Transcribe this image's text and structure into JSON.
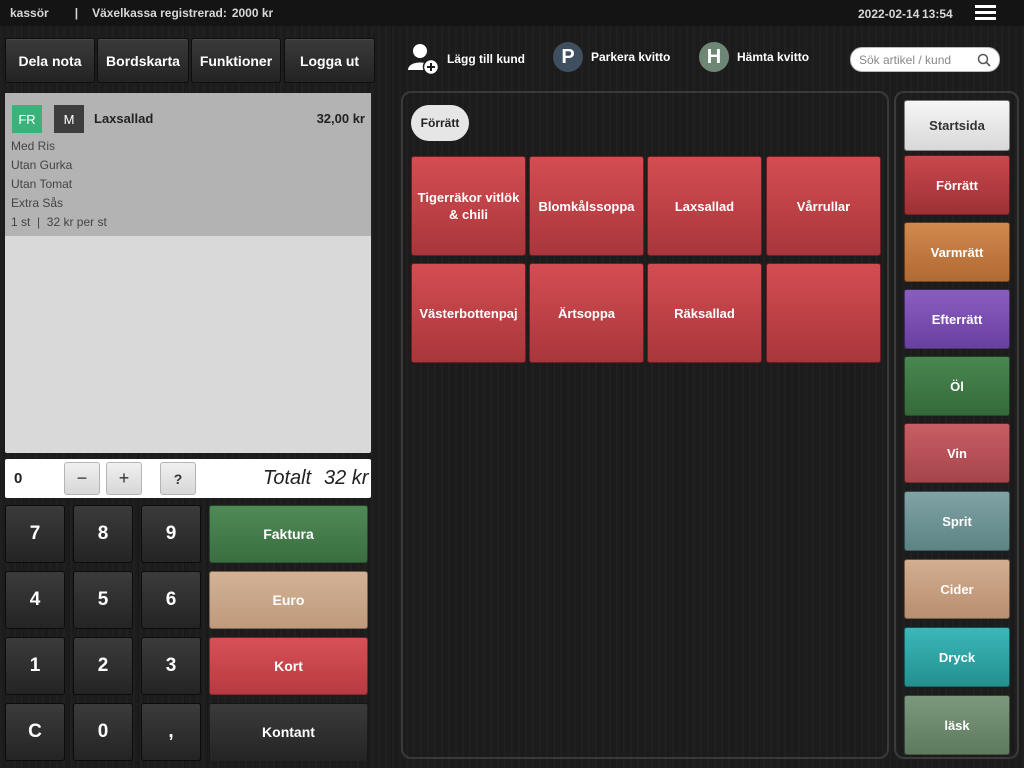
{
  "topbar": {
    "cashier": "kassör",
    "separator": "|",
    "register_label": "Växelkassa registrerad:",
    "register_amount": "2000 kr",
    "date": "2022-02-14",
    "time": "13:54"
  },
  "toolbar": {
    "split_bill": "Dela nota",
    "table_map": "Bordskarta",
    "functions": "Funktioner",
    "logout": "Logga ut"
  },
  "actions": {
    "add_customer": "Lägg till kund",
    "park_receipt": "Parkera kvitto",
    "park_icon_letter": "P",
    "fetch_receipt": "Hämta kvitto",
    "fetch_icon_letter": "H"
  },
  "search": {
    "placeholder": "Sök artikel / kund"
  },
  "receipt": {
    "item": {
      "badge_fr": "FR",
      "badge_m": "M",
      "name": "Laxsallad",
      "price": "32,00 kr",
      "modifiers": [
        "Med Ris",
        "Utan Gurka",
        "Utan Tomat",
        "Extra Sås"
      ],
      "qty_line": "1 st  |  32 kr per st"
    }
  },
  "qtybar": {
    "value": "0",
    "minus": "−",
    "plus": "+",
    "help": "?",
    "total_label": "Totalt",
    "total_value": "32 kr"
  },
  "keypad": [
    "7",
    "8",
    "9",
    "4",
    "5",
    "6",
    "1",
    "2",
    "3",
    "C",
    "0",
    ","
  ],
  "payments": {
    "invoice": "Faktura",
    "euro": "Euro",
    "card": "Kort",
    "cash": "Kontant"
  },
  "products": {
    "current_category": "Förrätt",
    "items": [
      "Tigerräkor vitlök & chili",
      "Blomkålssoppa",
      "Laxsallad",
      "Vårrullar",
      "Västerbottenpaj",
      "Ärtsoppa",
      "Räksallad",
      ""
    ]
  },
  "categories": [
    {
      "label": "Startsida",
      "color": "#e8e8e8"
    },
    {
      "label": "Förrätt",
      "color": "#b73d42"
    },
    {
      "label": "Varmrätt",
      "color": "#c47a3f"
    },
    {
      "label": "Efterrätt",
      "color": "#7a4eb0"
    },
    {
      "label": "Öl",
      "color": "#3f7a45"
    },
    {
      "label": "Vin",
      "color": "#b85157"
    },
    {
      "label": "Sprit",
      "color": "#6f9597"
    },
    {
      "label": "Cider",
      "color": "#c7a082"
    },
    {
      "label": "Dryck",
      "color": "#2ea5a8"
    },
    {
      "label": "läsk",
      "color": "#6e8a6f"
    }
  ],
  "colors": {
    "invoice": "#447d4c",
    "euro": "#c8a587",
    "card": "#c8444a",
    "badge_fr": "#3bb27a",
    "badge_m": "#3d3d3d",
    "park_icon": "#3f4f5f",
    "fetch_icon": "#6e8774"
  }
}
